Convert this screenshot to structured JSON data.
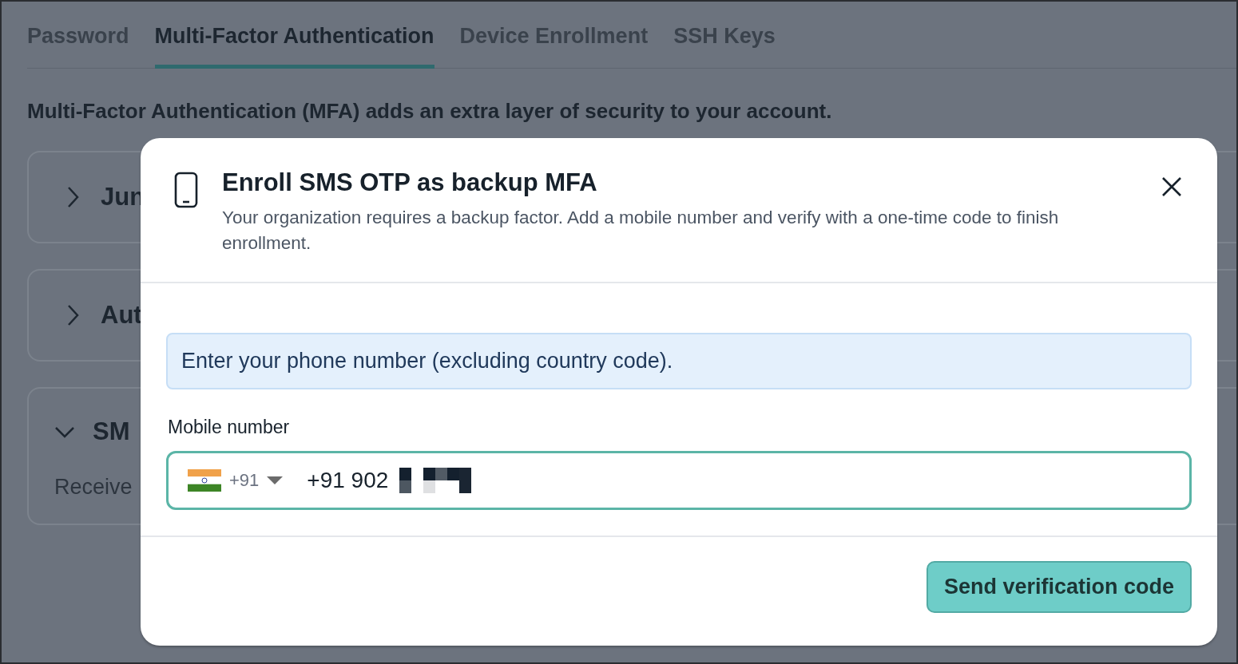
{
  "tabs": [
    {
      "label": "Password",
      "selected": false
    },
    {
      "label": "Multi-Factor Authentication",
      "selected": true
    },
    {
      "label": "Device Enrollment",
      "selected": false
    },
    {
      "label": "SSH Keys",
      "selected": false
    }
  ],
  "intro": "Multi-Factor Authentication (MFA) adds an extra layer of security to your account.",
  "sections": [
    {
      "title": "Jun",
      "expanded": false
    },
    {
      "title": "Aut",
      "expanded": false
    },
    {
      "title": "SM",
      "expanded": true,
      "body": "Receive"
    }
  ],
  "dialog": {
    "title": "Enroll SMS OTP as backup MFA",
    "description": "Your organization requires a backup factor. Add a mobile number and verify with a one-time code to finish enrollment.",
    "notice": "Enter your phone number (excluding country code).",
    "field": {
      "label": "Mobile number",
      "country_code": "+91",
      "value": "+91 902"
    },
    "button": "Send verification code"
  }
}
